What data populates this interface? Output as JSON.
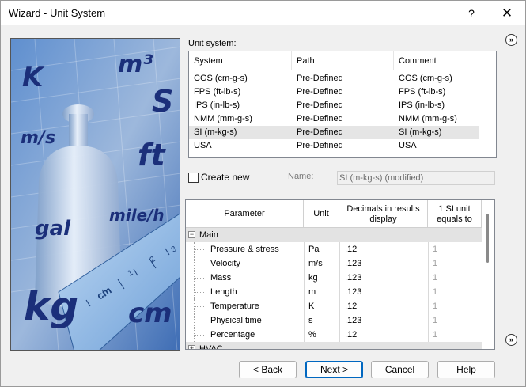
{
  "window": {
    "title": "Wizard - Unit System",
    "help_glyph": "?",
    "close_glyph": "✕"
  },
  "image": {
    "units": [
      "K",
      "m³",
      "S",
      "m/s",
      "ft",
      "gal",
      "mile/h",
      "kg",
      "cm"
    ],
    "ruler_label": "cm",
    "ruler_numbers": [
      "1",
      "2",
      "3"
    ]
  },
  "unit_system": {
    "label": "Unit system:",
    "columns": [
      "System",
      "Path",
      "Comment"
    ],
    "rows": [
      {
        "system": "CGS (cm-g-s)",
        "path": "Pre-Defined",
        "comment": "CGS (cm-g-s)",
        "selected": false
      },
      {
        "system": "FPS (ft-lb-s)",
        "path": "Pre-Defined",
        "comment": "FPS (ft-lb-s)",
        "selected": false
      },
      {
        "system": "IPS (in-lb-s)",
        "path": "Pre-Defined",
        "comment": "IPS (in-lb-s)",
        "selected": false
      },
      {
        "system": "NMM (mm-g-s)",
        "path": "Pre-Defined",
        "comment": "NMM (mm-g-s)",
        "selected": false
      },
      {
        "system": "SI (m-kg-s)",
        "path": "Pre-Defined",
        "comment": "SI (m-kg-s)",
        "selected": true
      },
      {
        "system": "USA",
        "path": "Pre-Defined",
        "comment": "USA",
        "selected": false
      }
    ]
  },
  "create_new": {
    "label": "Create new",
    "checked": false,
    "name_label": "Name:",
    "name_value": "SI (m-kg-s) (modified)"
  },
  "parameters": {
    "columns": {
      "parameter": "Parameter",
      "unit": "Unit",
      "decimals": "Decimals in results display",
      "equals": "1 SI unit equals to"
    },
    "group": {
      "expander": "−",
      "label": "Main"
    },
    "rows": [
      {
        "name": "Pressure & stress",
        "unit": "Pa",
        "decimals": ".12",
        "equals": "1"
      },
      {
        "name": "Velocity",
        "unit": "m/s",
        "decimals": ".123",
        "equals": "1"
      },
      {
        "name": "Mass",
        "unit": "kg",
        "decimals": ".123",
        "equals": "1"
      },
      {
        "name": "Length",
        "unit": "m",
        "decimals": ".123",
        "equals": "1"
      },
      {
        "name": "Temperature",
        "unit": "K",
        "decimals": ".12",
        "equals": "1"
      },
      {
        "name": "Physical time",
        "unit": "s",
        "decimals": ".123",
        "equals": "1"
      },
      {
        "name": "Percentage",
        "unit": "%",
        "decimals": ".12",
        "equals": "1"
      }
    ],
    "next_group": {
      "expander": "+",
      "label": "HVAC"
    }
  },
  "side_buttons": {
    "top": "»",
    "bottom": "»"
  },
  "buttons": {
    "back": "< Back",
    "next": "Next >",
    "cancel": "Cancel",
    "help": "Help"
  }
}
